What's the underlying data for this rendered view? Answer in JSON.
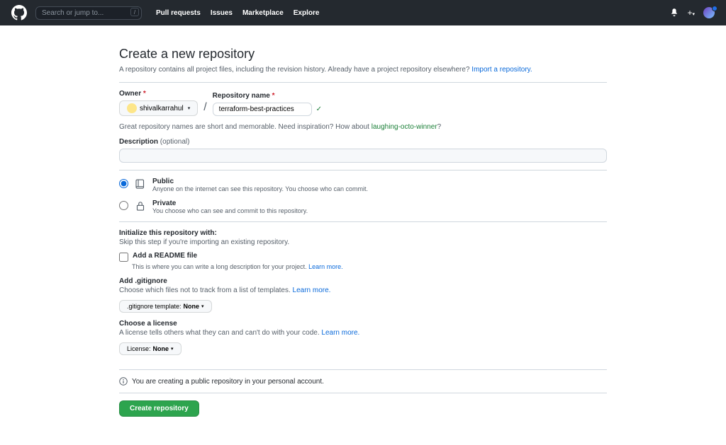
{
  "header": {
    "search_placeholder": "Search or jump to...",
    "nav": [
      "Pull requests",
      "Issues",
      "Marketplace",
      "Explore"
    ]
  },
  "page": {
    "title": "Create a new repository",
    "subtitle_1": "A repository contains all project files, including the revision history. Already have a project repository elsewhere? ",
    "import_link": "Import a repository."
  },
  "owner": {
    "label": "Owner",
    "value": "shivalkarrahul"
  },
  "repo": {
    "label": "Repository name",
    "value": "terraform-best-practices"
  },
  "hint": {
    "prefix": "Great repository names are short and memorable. Need inspiration? How about ",
    "suggestion": "laughing-octo-winner",
    "suffix": "?"
  },
  "description": {
    "label": "Description",
    "optional": "(optional)"
  },
  "visibility": {
    "public": {
      "title": "Public",
      "desc": "Anyone on the internet can see this repository. You choose who can commit."
    },
    "private": {
      "title": "Private",
      "desc": "You choose who can see and commit to this repository."
    }
  },
  "init": {
    "heading": "Initialize this repository with:",
    "sub": "Skip this step if you're importing an existing repository."
  },
  "readme": {
    "title": "Add a README file",
    "desc_prefix": "This is where you can write a long description for your project. ",
    "learn": "Learn more."
  },
  "gitignore": {
    "title": "Add .gitignore",
    "desc_prefix": "Choose which files not to track from a list of templates. ",
    "learn": "Learn more.",
    "button_prefix": ".gitignore template: ",
    "button_value": "None"
  },
  "license": {
    "title": "Choose a license",
    "desc_prefix": "A license tells others what they can and can't do with your code. ",
    "learn": "Learn more.",
    "button_prefix": "License: ",
    "button_value": "None"
  },
  "info": "You are creating a public repository in your personal account.",
  "submit": "Create repository"
}
